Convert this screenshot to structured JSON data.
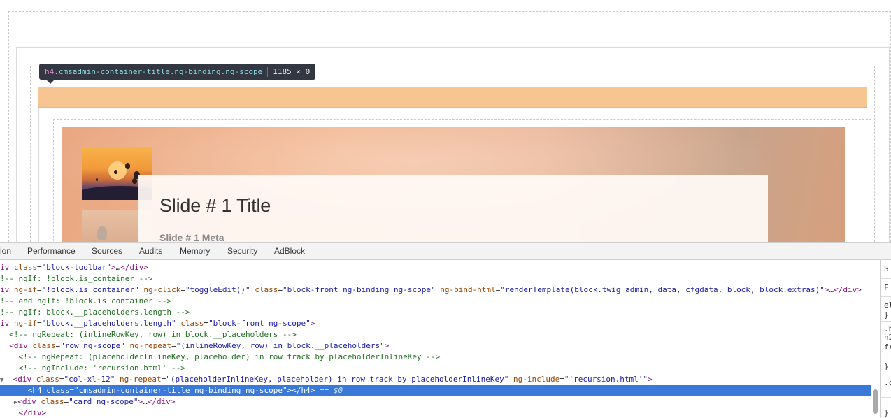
{
  "page": {
    "tooltip": {
      "tag": "h4",
      "classes": ".cmsadmin-container-title.ng-binding.ng-scope",
      "dims": "1185 × 0"
    },
    "slide": {
      "title": "Slide # 1 Title",
      "meta": "Slide # 1 Meta"
    }
  },
  "devtools": {
    "tabs": [
      "ion",
      "Performance",
      "Sources",
      "Audits",
      "Memory",
      "Security",
      "AdBlock"
    ],
    "lines": [
      {
        "html": "<span class='t'>iv</span> <span class='a'>class</span>=<span class='v'>\"block-toolbar\"</span><span class='t'>&gt;</span>…<span class='t'>&lt;/div&gt;</span>"
      },
      {
        "html": "<span class='c'>!-- ngIf: !block.is_container --&gt;</span>"
      },
      {
        "html": "<span class='t'>iv</span> <span class='a'>ng-if</span>=<span class='v'>\"!block.is_container\"</span> <span class='a'>ng-click</span>=<span class='v'>\"toggleEdit()\"</span> <span class='a'>class</span>=<span class='v'>\"block-front ng-binding ng-scope\"</span> <span class='a'>ng-bind-html</span>=<span class='v'>\"renderTemplate(block.twig_admin, data, cfgdata, block, block.extras)\"</span><span class='t'>&gt;</span>…<span class='t'>&lt;/div&gt;</span>"
      },
      {
        "html": "<span class='c'>!-- end ngIf: !block.is_container --&gt;</span>"
      },
      {
        "html": "<span class='c'>!-- ngIf: block.__placeholders.length --&gt;</span>"
      },
      {
        "html": "<span class='t'>iv</span> <span class='a'>ng-if</span>=<span class='v'>\"block.__placeholders.length\"</span> <span class='a'>class</span>=<span class='v'>\"block-front ng-scope\"</span><span class='t'>&gt;</span>"
      },
      {
        "html": "<span class='c'>  &lt;!-- ngRepeat: (inlineRowKey, row) in block.__placeholders --&gt;</span>"
      },
      {
        "html": "<span class='t'>  &lt;div</span> <span class='a'>class</span>=<span class='v'>\"row ng-scope\"</span> <span class='a'>ng-repeat</span>=<span class='v'>\"(inlineRowKey, row) in block.__placeholders\"</span><span class='t'>&gt;</span>"
      },
      {
        "html": "<span class='c'>    &lt;!-- ngRepeat: (placeholderInlineKey, placeholder) in row track by placeholderInlineKey --&gt;</span>"
      },
      {
        "html": "<span class='c'>    &lt;!-- ngInclude: 'recursion.html' --&gt;</span>"
      },
      {
        "html": "<span class='tri'>▼</span><span class='t'>  &lt;div</span> <span class='a'>class</span>=<span class='v'>\"col-xl-12\"</span> <span class='a'>ng-repeat</span>=<span class='v'>\"(placeholderInlineKey, placeholder) in row track by placeholderInlineKey\"</span> <span class='a'>ng-include</span>=<span class='v'>\"'recursion.html'\"</span><span class='t'>&gt;</span>"
      },
      {
        "html": "<span class='t'>      &lt;h4</span> <span class='a'>class</span>=<span class='v'>\"cmsadmin-container-title ng-binding ng-scope\"</span><span class='t'>&gt;&lt;/h4&gt;</span> <span class='eq'>== $0</span>",
        "selected": true
      },
      {
        "html": "   <span class='tri'>▶</span><span class='t'>&lt;div</span> <span class='a'>class</span>=<span class='v'>\"card ng-scope\"</span><span class='t'>&gt;</span>…<span class='t'>&lt;/div&gt;</span>"
      },
      {
        "html": "<span class='t'>    &lt;/div&gt;</span>"
      }
    ],
    "side": [
      "S",
      "F",
      "el",
      "}",
      ".b",
      "h2",
      "fr",
      "}",
      ".c",
      "}"
    ]
  }
}
